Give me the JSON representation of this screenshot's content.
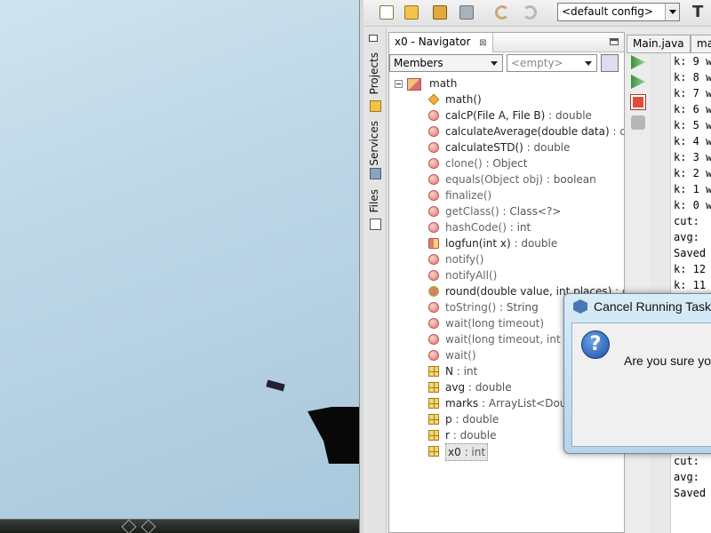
{
  "toolbar": {
    "config_value": "<default config>",
    "buttons": [
      "new-file-icon",
      "new-project-icon",
      "open-project-icon",
      "close-project-icon",
      "undo-icon",
      "redo-icon"
    ],
    "trailing_label": "T"
  },
  "side_tabs": [
    "Projects",
    "Services",
    "Files"
  ],
  "navigator": {
    "title": "x0 - Navigator",
    "close_glyph": "⊠",
    "view_combo": "Members",
    "filter_combo": "<empty>",
    "root": "math",
    "members": [
      {
        "kind": "ctor",
        "name": "math()",
        "inherited": false
      },
      {
        "kind": "method",
        "name": "calcP",
        "params": "(File A, File B)",
        "type": " : double",
        "inherited": false
      },
      {
        "kind": "method",
        "name": "calculateAverage",
        "params": "(double data)",
        "type": " : do",
        "inherited": false
      },
      {
        "kind": "method",
        "name": "calculateSTD",
        "params": "()",
        "type": " : double",
        "inherited": false
      },
      {
        "kind": "protected",
        "name": "clone",
        "params": "()",
        "type": " : Object",
        "inherited": true
      },
      {
        "kind": "method",
        "name": "equals",
        "params": "(Object obj)",
        "type": " : boolean",
        "inherited": true
      },
      {
        "kind": "protected",
        "name": "finalize",
        "params": "()",
        "type": "",
        "inherited": true
      },
      {
        "kind": "method",
        "name": "getClass",
        "params": "()",
        "type": " : Class<?>",
        "inherited": true
      },
      {
        "kind": "method",
        "name": "hashCode",
        "params": "()",
        "type": " : int",
        "inherited": true
      },
      {
        "kind": "mix",
        "name": "logfun",
        "params": "(int x)",
        "type": " : double",
        "inherited": false
      },
      {
        "kind": "method",
        "name": "notify",
        "params": "()",
        "type": "",
        "inherited": true
      },
      {
        "kind": "method",
        "name": "notifyAll",
        "params": "()",
        "type": "",
        "inherited": true
      },
      {
        "kind": "round",
        "name": "round",
        "params": "(double value, int places)",
        "type": " : do",
        "inherited": false
      },
      {
        "kind": "method",
        "name": "toString",
        "params": "()",
        "type": " : String",
        "inherited": true
      },
      {
        "kind": "method",
        "name": "wait",
        "params": "(long timeout)",
        "type": "",
        "inherited": true
      },
      {
        "kind": "method",
        "name": "wait",
        "params": "(long timeout, int n",
        "type": "",
        "inherited": true
      },
      {
        "kind": "method",
        "name": "wait",
        "params": "()",
        "type": "",
        "inherited": true
      },
      {
        "kind": "field",
        "name": "N",
        "params": "",
        "type": " : int",
        "inherited": false
      },
      {
        "kind": "field",
        "name": "avg",
        "params": "",
        "type": " : double",
        "inherited": false
      },
      {
        "kind": "field",
        "name": "marks",
        "params": "",
        "type": " : ArrayList<Doub",
        "inherited": false
      },
      {
        "kind": "field",
        "name": "p",
        "params": "",
        "type": " : double",
        "inherited": false
      },
      {
        "kind": "field",
        "name": "r",
        "params": "",
        "type": " : double",
        "inherited": false
      },
      {
        "kind": "field",
        "name": "x0",
        "params": "",
        "type": " : int",
        "inherited": false,
        "selected": true
      }
    ]
  },
  "editor": {
    "tabs": [
      "Main.java",
      "ma"
    ]
  },
  "output_lines": [
    "k: 9 w",
    "k: 8 w",
    "k: 7 w",
    "k: 6 w",
    "k: 5 w",
    "k: 4 w",
    "k: 3 w",
    "k: 2 w",
    "k: 1 w",
    "k: 0 w",
    "cut: ",
    "avg: ",
    "Saved",
    "k: 12",
    "k: 11",
    "",
    "",
    "",
    "",
    "",
    "",
    "",
    "",
    "",
    "k: 0 w",
    "cut: ",
    "avg: ",
    "Saved"
  ],
  "dialog": {
    "title": "Cancel Running Task",
    "icon": "question-icon",
    "icon_glyph": "?",
    "message": "Are you sure yo"
  }
}
